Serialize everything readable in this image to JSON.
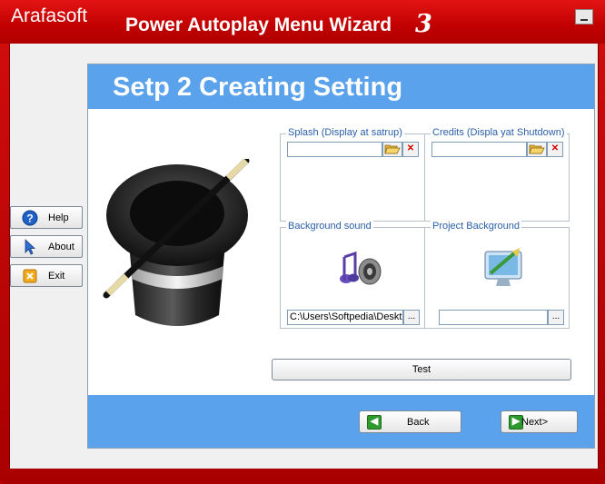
{
  "window": {
    "brand": "Arafasoft",
    "title": "Power Autoplay Menu Wizard",
    "version": "3"
  },
  "sidebar": {
    "buttons": [
      {
        "label": "Help",
        "icon": "help-icon"
      },
      {
        "label": "About",
        "icon": "cursor-icon"
      },
      {
        "label": "Exit",
        "icon": "exit-icon"
      }
    ]
  },
  "main": {
    "heading": "Setp 2 Creating Setting",
    "groups": {
      "splash": {
        "caption": "Splash (Display at satrup)",
        "value": ""
      },
      "credits": {
        "caption": "Credits (Displa yat Shutdown)",
        "value": ""
      },
      "background_sound": {
        "caption": "Background sound",
        "value": "C:\\Users\\Softpedia\\Deskt"
      },
      "project_background": {
        "caption": "Project Background",
        "value": ""
      }
    },
    "browse_label": "...",
    "test_label": "Test"
  },
  "footer": {
    "back_label": "Back",
    "next_label": "Next>"
  },
  "colors": {
    "frame": "#c40000",
    "banner": "#5aa2ec",
    "caption": "#2a5fa8"
  }
}
